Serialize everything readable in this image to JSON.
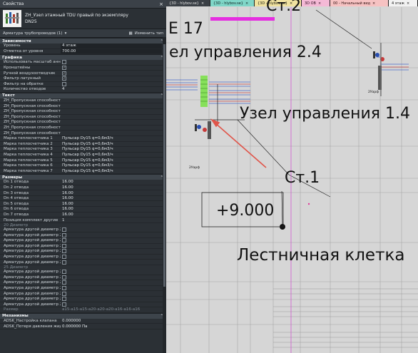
{
  "props": {
    "title": "Свойства",
    "close": "×",
    "type_name": "ZH_Узел этажный TDU правый по экземпляру",
    "type_sub": "DN25",
    "filter": "Арматура трубопроводов (1)",
    "edit_type": "Изменить тип",
    "groups": {
      "deps": "Зависимости",
      "graphics": "Графика",
      "text": "Текст",
      "sizes": "Размеры",
      "mech": "Механизмы"
    },
    "deps_rows": [
      {
        "k": "Уровень",
        "v": "4 этаж"
      },
      {
        "k": "Отметка от уровня",
        "v": "700.00"
      }
    ],
    "graphics_rows": [
      {
        "k": "Использовать масштаб аннотаций",
        "v": ""
      },
      {
        "k": "Кронштейны",
        "v": "✓"
      },
      {
        "k": "Ручной воздухоотводчик",
        "v": "✓"
      },
      {
        "k": "Фильтр латунный",
        "v": "✓"
      },
      {
        "k": "Фильтр на обратке",
        "v": ""
      }
    ],
    "graphics_count": {
      "k": "Количество отводов",
      "v": "4"
    },
    "text_rows": [
      {
        "k": "ZH_Пропускная способность 1-го отвода",
        "v": ""
      },
      {
        "k": "ZH_Пропускная способность 2-го отвода",
        "v": ""
      },
      {
        "k": "ZH_Пропускная способность 3-го отвода",
        "v": ""
      },
      {
        "k": "ZH_Пропускная способность 4-го отвода",
        "v": ""
      },
      {
        "k": "ZH_Пропускная способность 5-го отвода",
        "v": ""
      },
      {
        "k": "ZH_Пропускная способность 6-го отвода",
        "v": ""
      },
      {
        "k": "ZH_Пропускная способность 7-го отвода",
        "v": ""
      },
      {
        "k": "Марка теплосчетчика 1",
        "v": "Пульсар Dy15 q=0,6м3/ч"
      },
      {
        "k": "Марка теплосчетчика 2",
        "v": "Пульсар Dy15 q=0,6м3/ч"
      },
      {
        "k": "Марка теплосчетчика 3",
        "v": "Пульсар Dy15 q=0,6м3/ч"
      },
      {
        "k": "Марка теплосчетчика 4",
        "v": "Пульсар Dy15 q=0,6м3/ч"
      },
      {
        "k": "Марка теплосчетчика 5",
        "v": "Пульсар Dy15 q=0,6м3/ч"
      },
      {
        "k": "Марка теплосчетчика 6",
        "v": "Пульсар Dy15 q=0,6м3/ч"
      },
      {
        "k": "Марка теплосчетчика 7",
        "v": "Пульсар Dy15 q=0,6м3/ч"
      }
    ],
    "sizes_rows": [
      {
        "k": "Dn 1 отвода",
        "v": "16.00"
      },
      {
        "k": "Dn 2 отвода",
        "v": "16.00"
      },
      {
        "k": "Dn 3 отвода",
        "v": "16.00"
      },
      {
        "k": "Dn 4 отвода",
        "v": "16.00"
      },
      {
        "k": "Dn 5 отвода",
        "v": "16.00"
      },
      {
        "k": "Dn 6 отвода",
        "v": "16.00"
      },
      {
        "k": "Dn 7 отвода",
        "v": "16.00"
      },
      {
        "k": "Позиция комплект другие",
        "v": "1"
      }
    ],
    "sub20": "20 Диаметр",
    "d20_rows": [
      {
        "k": "Арматура другой диаметр 20 О1",
        "v": ""
      },
      {
        "k": "Арматура другой диаметр 20 О2",
        "v": ""
      },
      {
        "k": "Арматура другой диаметр 20 О3",
        "v": ""
      },
      {
        "k": "Арматура другой диаметр 20 О4",
        "v": ""
      },
      {
        "k": "Арматура другой диаметр 20 О5",
        "v": ""
      },
      {
        "k": "Арматура другой диаметр 20 О6",
        "v": ""
      },
      {
        "k": "Арматура другой диаметр 20 О7",
        "v": ""
      }
    ],
    "sub25": "25 Диаметр",
    "d25_rows": [
      {
        "k": "Арматура другой диаметр 25 О1",
        "v": ""
      },
      {
        "k": "Арматура другой диаметр 25 О2",
        "v": ""
      },
      {
        "k": "Арматура другой диаметр 25 О3",
        "v": ""
      },
      {
        "k": "Арматура другой диаметр 25 О4",
        "v": ""
      },
      {
        "k": "Арматура другой диаметр 25 О5",
        "v": ""
      },
      {
        "k": "Арматура другой диаметр 25 О6",
        "v": ""
      },
      {
        "k": "Арматура другой диаметр 25 О7",
        "v": ""
      }
    ],
    "sizes_footer": {
      "k": "Размер",
      "v": "a15-a15-a15-a20-a20-a20-a16-a16-a16"
    },
    "mech_rows": [
      {
        "k": "ADSK_Настройка клапана",
        "v": "0.000000"
      },
      {
        "k": "ADSK_Потеря давления жидкости",
        "v": "0.000000 Па"
      }
    ]
  },
  "tabs": [
    {
      "label": "{3D - hlybov.se}",
      "bg": "#3a3f45",
      "fg": "#e0e0e0"
    },
    {
      "label": "{3D - hlybov.se}",
      "bg": "#7fd6c8",
      "fg": "#102020"
    },
    {
      "label": "{3D - hlybov.se}",
      "bg": "#f0e2a0",
      "fg": "#202010"
    },
    {
      "label": "3D OB",
      "bg": "#f4b9d6",
      "fg": "#301020"
    },
    {
      "label": "00 - Начальный вид",
      "bg": "#f6c2c2",
      "fg": "#301010"
    },
    {
      "label": "4 этаж",
      "bg": "#f2f2f2",
      "fg": "#111111"
    }
  ],
  "canvas": {
    "top_st": "Ст.2",
    "e17": "E 17",
    "node24": "ел управления 2.4",
    "node14": "Узел управления 1.4",
    "st1": "Ст.1",
    "elevation": "+9.000",
    "stair": "Лестничная клетка",
    "small_label": "2Уарф",
    "colors": {
      "magenta": "#e52ee0",
      "arrow": "#e0554a",
      "green": "#86e05a",
      "leader": "#222222"
    }
  }
}
